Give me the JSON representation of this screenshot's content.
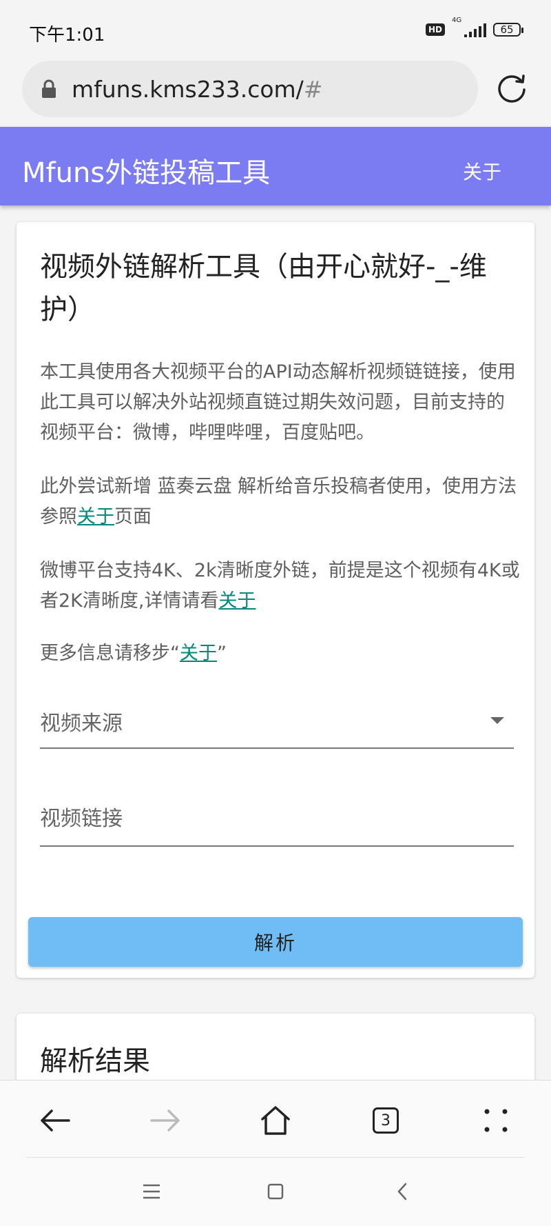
{
  "status_bar": {
    "time": "下午1:01",
    "hd": "HD",
    "network": "4G",
    "battery": "65"
  },
  "browser": {
    "url_main": "mfuns.kms233.com/",
    "url_hash": "#",
    "tab_count": "3"
  },
  "app_bar": {
    "title": "Mfuns外链投稿工具",
    "about": "关于"
  },
  "main_card": {
    "title": "视频外链解析工具（由开心就好-_-维护）",
    "p1": "本工具使用各大视频平台的API动态解析视频链链接，使用此工具可以解决外站视频直链过期失效问题，目前支持的视频平台：微博，哔哩哔哩，百度贴吧。",
    "p2_before": "此外尝试新增 蓝奏云盘 解析给音乐投稿者使用，使用方法参照",
    "p2_link": "关于",
    "p2_after": "页面",
    "p3_before": "微博平台支持4K、2k清晰度外链，前提是这个视频有4K或者2K清晰度,详情请看",
    "p3_link": "关于",
    "p4_before": "更多信息请移步“",
    "p4_link": "关于",
    "p4_after": "”",
    "select_label": "视频来源",
    "input_placeholder": "视频链接",
    "input_value": "",
    "button_label": "解析"
  },
  "result_card": {
    "title": "解析结果"
  },
  "colors": {
    "app_bar": "#7c7cf2",
    "button": "#70bdf6",
    "link": "#00897b"
  },
  "icons": [
    "lock-icon",
    "reload-icon",
    "caret-down-icon",
    "back-arrow-icon",
    "forward-arrow-icon",
    "home-icon",
    "tabs-icon",
    "menu-dots-icon",
    "recents-icon",
    "square-home-icon",
    "chevron-back-icon"
  ]
}
